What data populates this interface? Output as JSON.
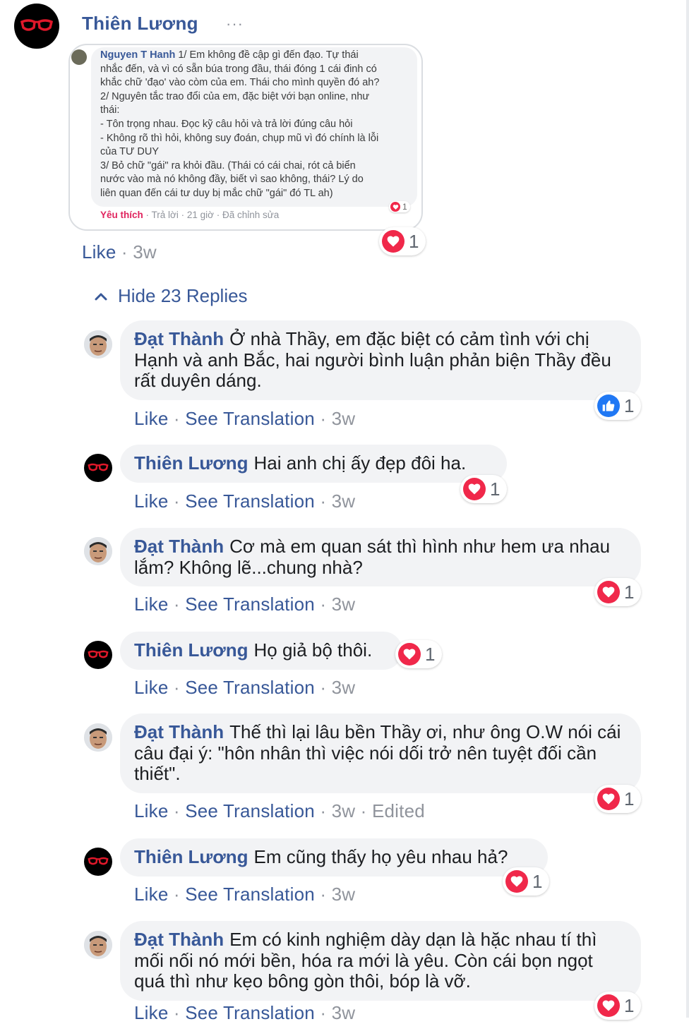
{
  "post": {
    "author": "Thiên Lương",
    "more_dots": "···",
    "like_label": "Like",
    "time": "3w",
    "reaction_count": "1",
    "screenshot": {
      "author": "Nguyen T Hanh",
      "text": " 1/ Em không đề cập gì đến đạo. Tự thái\nnhắc đến, và vì có sẵn búa trong đầu, thái đóng 1 cái đinh có\nkhắc chữ 'đạo' vào còm của em. Thái cho mình quyền đó ah?\n2/ Nguyên tắc trao đổi của em, đặc biệt với bạn online, như\nthái:\n- Tôn trọng nhau. Đọc kỹ câu hỏi và trả lời đúng câu hỏi\n- Không rõ thì hỏi, không suy đoán, chụp mũ vì đó chính là lỗi\ncủa TƯ DUY\n3/ Bỏ chữ \"gái\" ra khỏi đầu. (Thái có cái chai, rót cả biển\nnước vào mà nó không đầy, biết vì sao không, thái? Lý do\nliên quan đến cái tư duy bị mắc chữ \"gái\" đó TL ah)",
      "like_label": "Yêu thích",
      "meta": " · Trả lời · 21 giờ · Đã chỉnh sửa",
      "reaction_count": "1"
    }
  },
  "replies_toggle": "Hide 23 Replies",
  "actions": {
    "like": "Like",
    "translate": "See Translation",
    "sep": " · "
  },
  "replies": [
    {
      "author": "Đạt Thành",
      "text": "Ở nhà Thầy, em đặc biệt có cảm tình với chị Hạnh và anh Bắc, hai người bình luận phản biện Thầy đều rất duyên dáng.",
      "time": "3w",
      "reaction": "like",
      "count": "1",
      "edited": ""
    },
    {
      "author": "Thiên Lương",
      "text": "Hai anh chị ấy đẹp đôi ha.",
      "time": "3w",
      "reaction": "love",
      "count": "1",
      "edited": ""
    },
    {
      "author": "Đạt Thành",
      "text": "Cơ mà em quan sát thì hình như hem ưa nhau lắm? Không lẽ...chung nhà?",
      "time": "3w",
      "reaction": "love",
      "count": "1",
      "edited": ""
    },
    {
      "author": "Thiên Lương",
      "text": "Họ giả bộ thôi.",
      "time": "3w",
      "reaction": "love",
      "count": "1",
      "edited": ""
    },
    {
      "author": "Đạt Thành",
      "text": "Thế thì lại lâu bền Thầy ơi, như ông O.W nói cái câu đại ý: \"hôn nhân thì việc nói dối trở nên tuyệt đối cần thiết\".",
      "time": "3w",
      "reaction": "love",
      "count": "1",
      "edited": "Edited"
    },
    {
      "author": "Thiên Lương",
      "text": "Em cũng thấy họ yêu nhau hả?",
      "time": "3w",
      "reaction": "love",
      "count": "1",
      "edited": ""
    },
    {
      "author": "Đạt Thành",
      "text": "Em có kinh nghiệm dày dạn là hặc nhau tí thì mối nối nó mới bền, hóa ra mới là yêu. Còn cái bọn ngọt quá thì như kẹo bông gòn thôi, bóp là vỡ.",
      "time": "3w",
      "reaction": "love",
      "count": "1",
      "edited": ""
    }
  ],
  "colors": {
    "link": "#385898",
    "muted": "#90949c",
    "bubble": "#f2f3f5",
    "love": "#f0284a",
    "like": "#2078f4"
  }
}
